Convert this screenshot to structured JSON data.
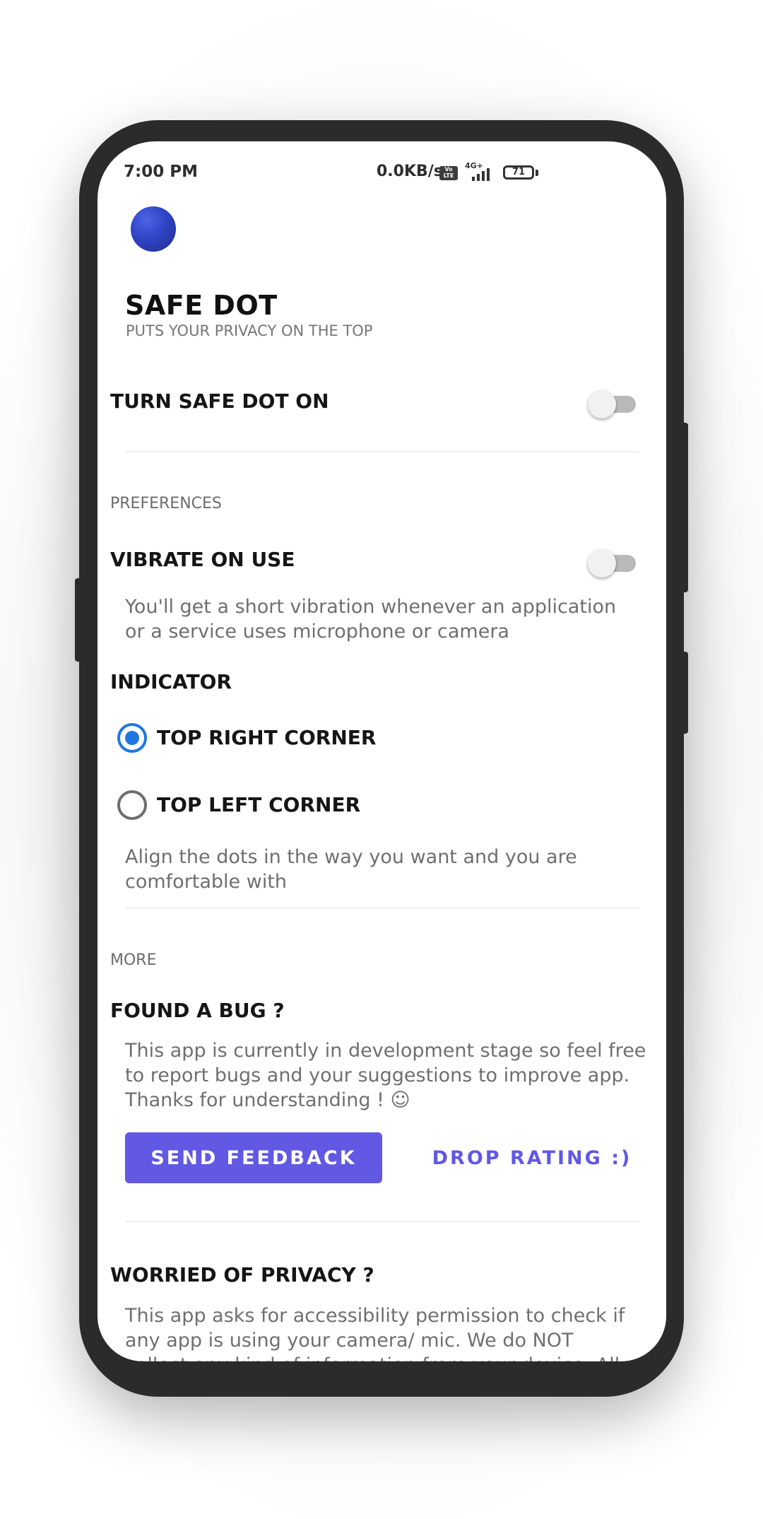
{
  "status_bar": {
    "time": "7:00 PM",
    "network_speed": "0.0KB/s",
    "volte_label": "Vo LTE",
    "signal_label": "4G+",
    "battery": "71"
  },
  "app": {
    "title": "SAFE DOT",
    "subtitle": "PUTS YOUR PRIVACY ON THE TOP"
  },
  "main_toggle": {
    "label": "TURN SAFE DOT ON",
    "on": false
  },
  "preferences": {
    "header": "PREFERENCES",
    "vibrate": {
      "label": "VIBRATE ON USE",
      "on": false,
      "description": "You'll get a short vibration whenever an application or a service uses microphone or camera"
    },
    "indicator": {
      "label": "INDICATOR",
      "options": [
        {
          "label": "TOP RIGHT CORNER",
          "selected": true
        },
        {
          "label": "TOP LEFT CORNER",
          "selected": false
        }
      ],
      "description": "Align the dots in the way you want and you are comfortable with"
    }
  },
  "more": {
    "header": "MORE",
    "bug": {
      "title": "FOUND A BUG ?",
      "description": "This app is currently in development stage so feel free to report bugs and your suggestions to improve app. Thanks for understanding ! ☺"
    },
    "buttons": {
      "feedback": "SEND FEEDBACK",
      "rating": "DROP RATING :)"
    },
    "privacy": {
      "title": "WORRIED OF PRIVACY ?",
      "description": "This app asks for accessibility permission to check if any app is using your camera/ mic. We do NOT collect any kind of information from your device. All the"
    }
  },
  "colors": {
    "accent": "#6158e4",
    "radio_selected": "#1e77df",
    "dot": "#2e44c4"
  }
}
